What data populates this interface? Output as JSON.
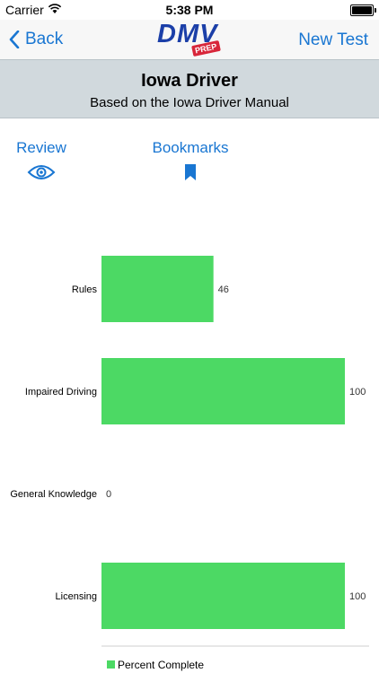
{
  "status_bar": {
    "carrier": "Carrier",
    "time": "5:38 PM"
  },
  "nav": {
    "back_label": "Back",
    "logo_text": "DMV",
    "logo_badge": "PREP",
    "new_test_label": "New Test"
  },
  "header": {
    "title": "Iowa Driver",
    "subtitle": "Based on the Iowa Driver Manual"
  },
  "tabs": [
    {
      "label": "Review",
      "icon": "eye-icon"
    },
    {
      "label": "Bookmarks",
      "icon": "bookmark-icon"
    }
  ],
  "colors": {
    "accent": "#1976d2",
    "bar": "#4cd964",
    "header_bg": "#d1d9dd"
  },
  "chart_data": {
    "type": "bar",
    "orientation": "horizontal",
    "categories": [
      "Rules",
      "Impaired Driving",
      "General Knowledge",
      "Licensing"
    ],
    "series": [
      {
        "name": "Percent Complete",
        "values": [
          46,
          100,
          0,
          100
        ]
      }
    ],
    "xlim": [
      0,
      100
    ],
    "value_labels": [
      "46",
      "100",
      "0",
      "100"
    ],
    "legend_position": "bottom-left",
    "grid": false
  }
}
